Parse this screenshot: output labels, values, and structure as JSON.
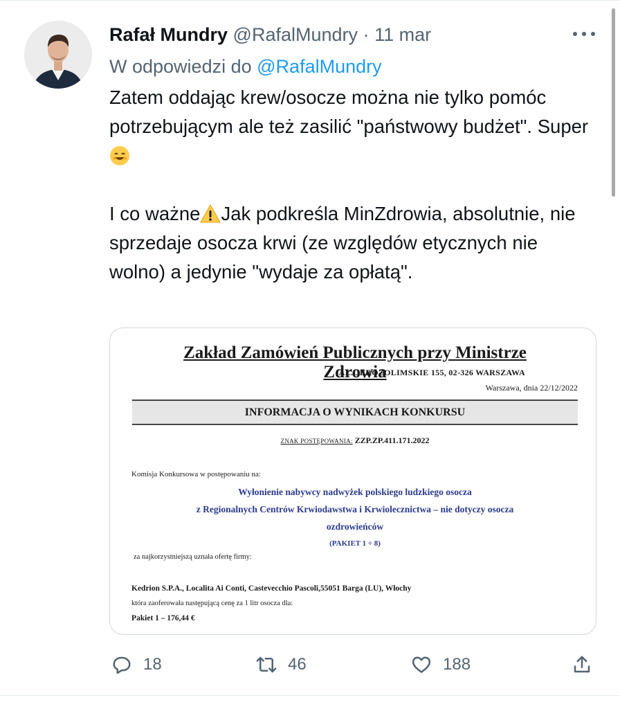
{
  "tweet": {
    "author_name": "Rafał Mundry",
    "author_handle": "@RafalMundry",
    "separator": "·",
    "date": "11 mar",
    "reply_prefix": "W odpowiedzi do",
    "reply_handle": "@RafalMundry",
    "text_line1": "Zatem oddając krew/osocze można nie tylko pomóc potrzebującym ale też zasilić \"państwowy budżet\". Super",
    "text_line2_a": "I co ważne",
    "text_line2_b": "Jak podkreśla MinZdrowia, absolutnie, nie sprzedaje osocza krwi (ze względów etycznych nie wolno) a jedynie \"wydaje za opłatą\".",
    "icons": {
      "avatar": "avatar-photo",
      "more": "more-icon",
      "emoji_smile": "smiling-face-emoji",
      "emoji_warning": "warning-emoji",
      "reply": "reply-icon",
      "retweet": "retweet-icon",
      "like": "heart-icon",
      "share": "share-icon"
    }
  },
  "document": {
    "title": "Zakład Zamówień Publicznych przy Ministrze Zdrowia",
    "address": "AL. JEROZOLIMSKIE 155, 02-326 WARSZAWA",
    "date": "Warszawa, dnia 22/12/2022",
    "heading": "INFORMACJA O WYNIKACH KONKURSU",
    "case_label": "ZNAK POSTĘPOWANIA:",
    "case_value": "ZZP.ZP.411.171.2022",
    "committee": "Komisja  Konkursowa w postępowaniu  na:",
    "subject_1": "Wyłonienie nabywcy nadwyżek polskiego ludzkiego osocza",
    "subject_2": "z Regionalnych Centrów Krwiodawstwa i Krwiolecznictwa – nie dotyczy osocza",
    "subject_3": "ozdrowieńców",
    "package_range": "(PAKIET 1 ÷ 8)",
    "best_offer": "za najkorzystniejszą uznała ofertę firmy:",
    "company": "Kedrion S.P.A., Localita Ai Conti, Castevecchio Pascoli,55051 Barga (LU), Włochy",
    "offered": "która zaoferowała następującą cenę za  1 litr osocza dla:",
    "package_1": "Pakiet 1  –  176,44 €"
  },
  "actions": {
    "replies": "18",
    "retweets": "46",
    "likes": "188"
  },
  "colors": {
    "text": "#0f1419",
    "muted": "#536471",
    "link": "#1d9bf0",
    "doc_subject": "#2b3a8c"
  }
}
